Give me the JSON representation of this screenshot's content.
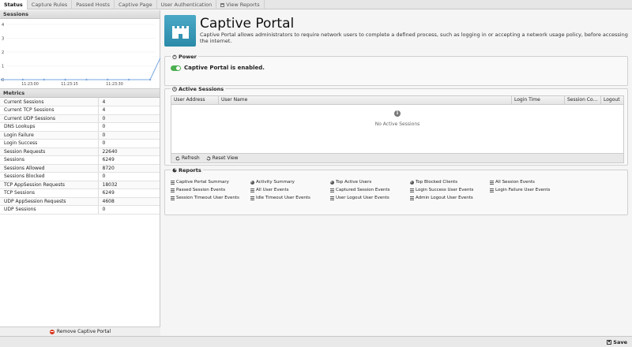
{
  "tabs": [
    {
      "label": "Status",
      "active": true
    },
    {
      "label": "Capture Rules"
    },
    {
      "label": "Passed Hosts"
    },
    {
      "label": "Captive Page"
    },
    {
      "label": "User Authentication"
    },
    {
      "label": "View Reports",
      "icon": "calendar-icon"
    }
  ],
  "left": {
    "sessions_header": "Sessions",
    "metrics_header": "Metrics",
    "remove_label": "Remove Captive Portal"
  },
  "chart_data": {
    "type": "line",
    "y_ticks": [
      "4",
      "3",
      "2",
      "1",
      "0"
    ],
    "x_ticks": [
      "11:23:00",
      "11:23:15",
      "11:23:30"
    ],
    "ylim": [
      0,
      4
    ],
    "series": [
      {
        "values": [
          0,
          0,
          0,
          0,
          0,
          0,
          0,
          0,
          4
        ]
      }
    ],
    "color": "#7aa7e0"
  },
  "metrics": [
    {
      "name": "Current Sessions",
      "value": "4"
    },
    {
      "name": "Current TCP Sessions",
      "value": "4"
    },
    {
      "name": "Current UDP Sessions",
      "value": "0"
    },
    {
      "name": "DNS Lookups",
      "value": "0"
    },
    {
      "name": "Login Failure",
      "value": "0"
    },
    {
      "name": "Login Success",
      "value": "0"
    },
    {
      "name": "Session Requests",
      "value": "22640"
    },
    {
      "name": "Sessions",
      "value": "6249"
    },
    {
      "name": "Sessions Allowed",
      "value": "8720"
    },
    {
      "name": "Sessions Blocked",
      "value": "0"
    },
    {
      "name": "TCP AppSession Requests",
      "value": "18032"
    },
    {
      "name": "TCP Sessions",
      "value": "6249"
    },
    {
      "name": "UDP AppSession Requests",
      "value": "4608"
    },
    {
      "name": "UDP Sessions",
      "value": "0"
    }
  ],
  "app": {
    "title": "Captive Portal",
    "description": "Captive Portal allows administrators to require network users to complete a defined process, such as logging in or accepting a network usage policy, before accessing the internet."
  },
  "power": {
    "legend": "Power",
    "status": "Captive Portal is enabled."
  },
  "active_sessions": {
    "legend": "Active Sessions",
    "columns": [
      "User Address",
      "User Name",
      "Login Time",
      "Session Co...",
      "Logout"
    ],
    "empty_text": "No Active Sessions",
    "refresh_label": "Refresh",
    "reset_label": "Reset View"
  },
  "reports": {
    "legend": "Reports",
    "items": [
      {
        "label": "Captive Portal Summary",
        "icon": "list-icon"
      },
      {
        "label": "Activity Summary",
        "icon": "pie-icon"
      },
      {
        "label": "Top Active Users",
        "icon": "pie-icon"
      },
      {
        "label": "Top Blocked Clients",
        "icon": "pie-icon"
      },
      {
        "label": "All Session Events",
        "icon": "list-icon"
      },
      {
        "label": "Passed Session Events",
        "icon": "list-icon"
      },
      {
        "label": "All User Events",
        "icon": "list-icon"
      },
      {
        "label": "Captured Session Events",
        "icon": "list-icon"
      },
      {
        "label": "Login Success User Events",
        "icon": "list-icon"
      },
      {
        "label": "Login Failure User Events",
        "icon": "list-icon"
      },
      {
        "label": "Session Timeout User Events",
        "icon": "list-icon"
      },
      {
        "label": "Idle Timeout User Events",
        "icon": "list-icon"
      },
      {
        "label": "User Logout User Events",
        "icon": "list-icon"
      },
      {
        "label": "Admin Logout User Events",
        "icon": "list-icon"
      }
    ]
  },
  "footer": {
    "save_label": "Save"
  }
}
